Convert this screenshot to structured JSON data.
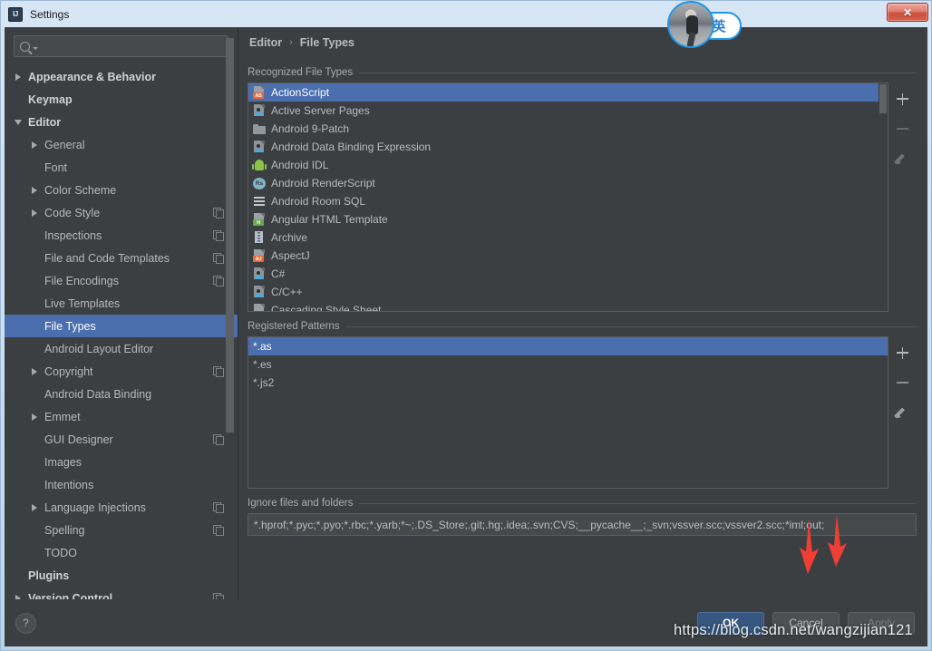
{
  "window": {
    "title": "Settings",
    "app_icon": "intellij-idea-icon",
    "close_label": "✕"
  },
  "sidebar": {
    "search": {
      "placeholder": "",
      "value": "",
      "icon": "search-icon"
    },
    "items": [
      {
        "label": "Appearance & Behavior",
        "twisty": "right",
        "indent": 0,
        "bold": true,
        "copy": false,
        "selected": false
      },
      {
        "label": "Keymap",
        "twisty": "none",
        "indent": 0,
        "bold": true,
        "copy": false,
        "selected": false
      },
      {
        "label": "Editor",
        "twisty": "down",
        "indent": 0,
        "bold": true,
        "copy": false,
        "selected": false
      },
      {
        "label": "General",
        "twisty": "right",
        "indent": 1,
        "bold": false,
        "copy": false,
        "selected": false
      },
      {
        "label": "Font",
        "twisty": "none",
        "indent": 1,
        "bold": false,
        "copy": false,
        "selected": false
      },
      {
        "label": "Color Scheme",
        "twisty": "right",
        "indent": 1,
        "bold": false,
        "copy": false,
        "selected": false
      },
      {
        "label": "Code Style",
        "twisty": "right",
        "indent": 1,
        "bold": false,
        "copy": true,
        "selected": false
      },
      {
        "label": "Inspections",
        "twisty": "none",
        "indent": 1,
        "bold": false,
        "copy": true,
        "selected": false
      },
      {
        "label": "File and Code Templates",
        "twisty": "none",
        "indent": 1,
        "bold": false,
        "copy": true,
        "selected": false
      },
      {
        "label": "File Encodings",
        "twisty": "none",
        "indent": 1,
        "bold": false,
        "copy": true,
        "selected": false
      },
      {
        "label": "Live Templates",
        "twisty": "none",
        "indent": 1,
        "bold": false,
        "copy": false,
        "selected": false
      },
      {
        "label": "File Types",
        "twisty": "none",
        "indent": 1,
        "bold": false,
        "copy": false,
        "selected": true
      },
      {
        "label": "Android Layout Editor",
        "twisty": "none",
        "indent": 1,
        "bold": false,
        "copy": false,
        "selected": false
      },
      {
        "label": "Copyright",
        "twisty": "right",
        "indent": 1,
        "bold": false,
        "copy": true,
        "selected": false
      },
      {
        "label": "Android Data Binding",
        "twisty": "none",
        "indent": 1,
        "bold": false,
        "copy": false,
        "selected": false
      },
      {
        "label": "Emmet",
        "twisty": "right",
        "indent": 1,
        "bold": false,
        "copy": false,
        "selected": false
      },
      {
        "label": "GUI Designer",
        "twisty": "none",
        "indent": 1,
        "bold": false,
        "copy": true,
        "selected": false
      },
      {
        "label": "Images",
        "twisty": "none",
        "indent": 1,
        "bold": false,
        "copy": false,
        "selected": false
      },
      {
        "label": "Intentions",
        "twisty": "none",
        "indent": 1,
        "bold": false,
        "copy": false,
        "selected": false
      },
      {
        "label": "Language Injections",
        "twisty": "right",
        "indent": 1,
        "bold": false,
        "copy": true,
        "selected": false
      },
      {
        "label": "Spelling",
        "twisty": "none",
        "indent": 1,
        "bold": false,
        "copy": true,
        "selected": false
      },
      {
        "label": "TODO",
        "twisty": "none",
        "indent": 1,
        "bold": false,
        "copy": false,
        "selected": false
      },
      {
        "label": "Plugins",
        "twisty": "none",
        "indent": 0,
        "bold": true,
        "copy": false,
        "selected": false
      },
      {
        "label": "Version Control",
        "twisty": "right",
        "indent": 0,
        "bold": true,
        "copy": true,
        "selected": false
      }
    ]
  },
  "breadcrumb": {
    "parent": "Editor",
    "separator": "›",
    "current": "File Types"
  },
  "recognized": {
    "section_label": "Recognized File Types",
    "items": [
      {
        "label": "ActionScript",
        "icon": "actionscript-file-icon",
        "selected": true
      },
      {
        "label": "Active Server Pages",
        "icon": "asp-file-icon",
        "selected": false
      },
      {
        "label": "Android 9-Patch",
        "icon": "folder-file-icon",
        "selected": false
      },
      {
        "label": "Android Data Binding Expression",
        "icon": "asp-file-icon",
        "selected": false
      },
      {
        "label": "Android IDL",
        "icon": "android-robot-icon",
        "selected": false
      },
      {
        "label": "Android RenderScript",
        "icon": "renderscript-icon",
        "selected": false
      },
      {
        "label": "Android Room SQL",
        "icon": "sql-file-icon",
        "selected": false
      },
      {
        "label": "Angular HTML Template",
        "icon": "angular-html-icon",
        "selected": false
      },
      {
        "label": "Archive",
        "icon": "archive-file-icon",
        "selected": false
      },
      {
        "label": "AspectJ",
        "icon": "aspectj-file-icon",
        "selected": false
      },
      {
        "label": "C#",
        "icon": "asp-file-icon",
        "selected": false
      },
      {
        "label": "C/C++",
        "icon": "asp-file-icon",
        "selected": false
      },
      {
        "label": "Cascading Style Sheet",
        "icon": "generic-file-icon",
        "selected": false
      }
    ],
    "toolbar": [
      {
        "name": "add-file-type-button",
        "icon": "plus-icon",
        "enabled": true
      },
      {
        "name": "remove-file-type-button",
        "icon": "minus-icon",
        "enabled": false
      },
      {
        "name": "edit-file-type-button",
        "icon": "pencil-icon",
        "enabled": false
      }
    ]
  },
  "patterns": {
    "section_label": "Registered Patterns",
    "items": [
      {
        "label": "*.as",
        "selected": true
      },
      {
        "label": "*.es",
        "selected": false
      },
      {
        "label": "*.js2",
        "selected": false
      }
    ],
    "toolbar": [
      {
        "name": "add-pattern-button",
        "icon": "plus-icon",
        "enabled": true
      },
      {
        "name": "remove-pattern-button",
        "icon": "minus-icon",
        "enabled": true
      },
      {
        "name": "edit-pattern-button",
        "icon": "pencil-icon",
        "enabled": true
      }
    ]
  },
  "ignore": {
    "section_label": "Ignore files and folders",
    "value": "*.hprof;*.pyc;*.pyo;*.rbc;*.yarb;*~;.DS_Store;.git;.hg;.idea;.svn;CVS;__pycache__;_svn;vssver.scc;vssver2.scc;*iml;out;",
    "placeholder": ""
  },
  "footer": {
    "help_label": "?",
    "ok_label": "OK",
    "cancel_label": "Cancel",
    "apply_label": "Apply"
  },
  "overlays": {
    "watermark": "https://blog.csdn.net/wangzijian121",
    "ime_mode": "英",
    "arrow_color": "#ef3e36",
    "arrow_count": 2
  },
  "colors": {
    "accent_selection": "#4b6eaf",
    "panel_bg": "#3c3f41",
    "field_bg": "#45494a",
    "text": "#b8babd",
    "primary_button": "#365880"
  }
}
